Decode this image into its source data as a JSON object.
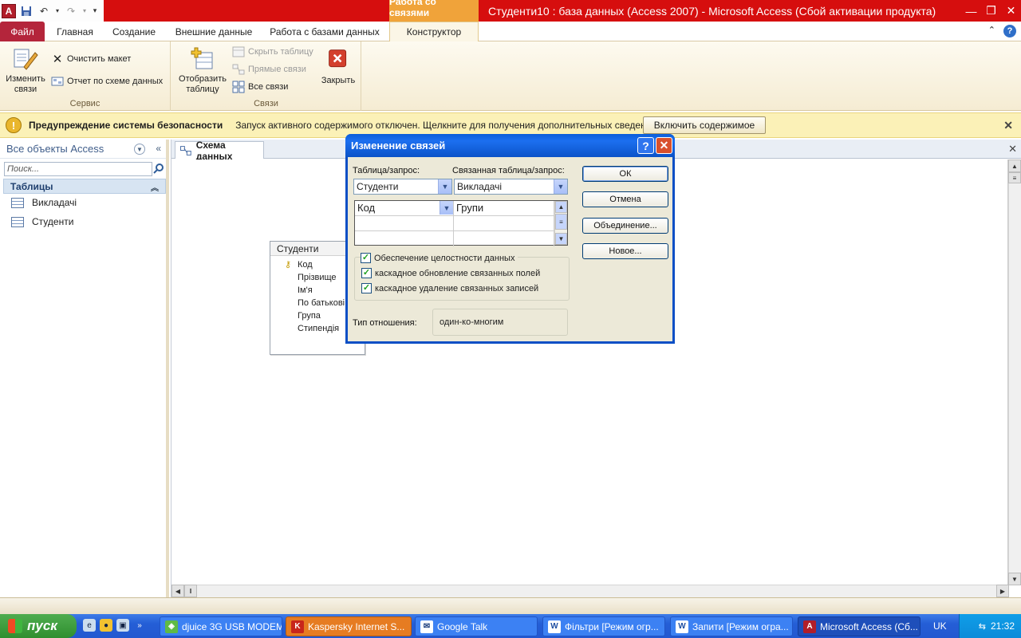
{
  "window": {
    "app_icon_letter": "A",
    "context_tab_header": "Работа со связями",
    "title": "Студенти10 : база данных (Access 2007)  -  Microsoft Access (Сбой активации продукта)",
    "minimize": "—",
    "restore": "❐",
    "close": "✕"
  },
  "ribbon_tabs": {
    "file": "Файл",
    "home": "Главная",
    "create": "Создание",
    "external": "Внешние данные",
    "dbtools": "Работа с базами данных",
    "design": "Конструктор",
    "help": "?"
  },
  "ribbon": {
    "edit_relationships": "Изменить связи",
    "clear_layout": "Очистить макет",
    "relationship_report": "Отчет по схеме данных",
    "group_tools": "Сервис",
    "show_table": "Отобразить таблицу",
    "hide_table": "Скрыть таблицу",
    "direct_relationships": "Прямые связи",
    "all_relationships": "Все связи",
    "close": "Закрыть",
    "group_relationships": "Связи"
  },
  "security_bar": {
    "title": "Предупреждение системы безопасности",
    "message": "Запуск активного содержимого отключен. Щелкните для получения дополнительных сведений.",
    "enable_button": "Включить содержимое"
  },
  "nav_pane": {
    "header": "Все объекты Access",
    "search_placeholder": "Поиск...",
    "group": "Таблицы",
    "items": [
      "Викладачі",
      "Студенти"
    ]
  },
  "document": {
    "tab_label": "Схема данных",
    "field_list": {
      "title": "Студенти",
      "fields": [
        "Код",
        "Прізвище",
        "Ім'я",
        "По батькові",
        "Група",
        "Стипендія"
      ]
    }
  },
  "dialog": {
    "title": "Изменение связей",
    "table_label": "Таблица/запрос:",
    "related_label": "Связанная таблица/запрос:",
    "table_value": "Студенти",
    "related_value": "Викладачі",
    "grid_left": "Код",
    "grid_right": "Групи",
    "ok": "ОК",
    "cancel": "Отмена",
    "join": "Объединение...",
    "new": "Новое...",
    "opt_integrity": "Обеспечение целостности данных",
    "opt_cascade_update": "каскадное обновление связанных полей",
    "opt_cascade_delete": "каскадное удаление связанных записей",
    "checked": "✓",
    "reltype_label": "Тип отношения:",
    "reltype_value": "один-ко-многим"
  },
  "taskbar": {
    "start": "пуск",
    "tasks": [
      "djuice 3G USB MODEM",
      "Kaspersky Internet S...",
      "Google Talk",
      "Фільтри [Режим огр...",
      "Запити [Режим огра...",
      "Microsoft Access (Сб..."
    ],
    "lang": "UK",
    "clock": "21:32"
  }
}
